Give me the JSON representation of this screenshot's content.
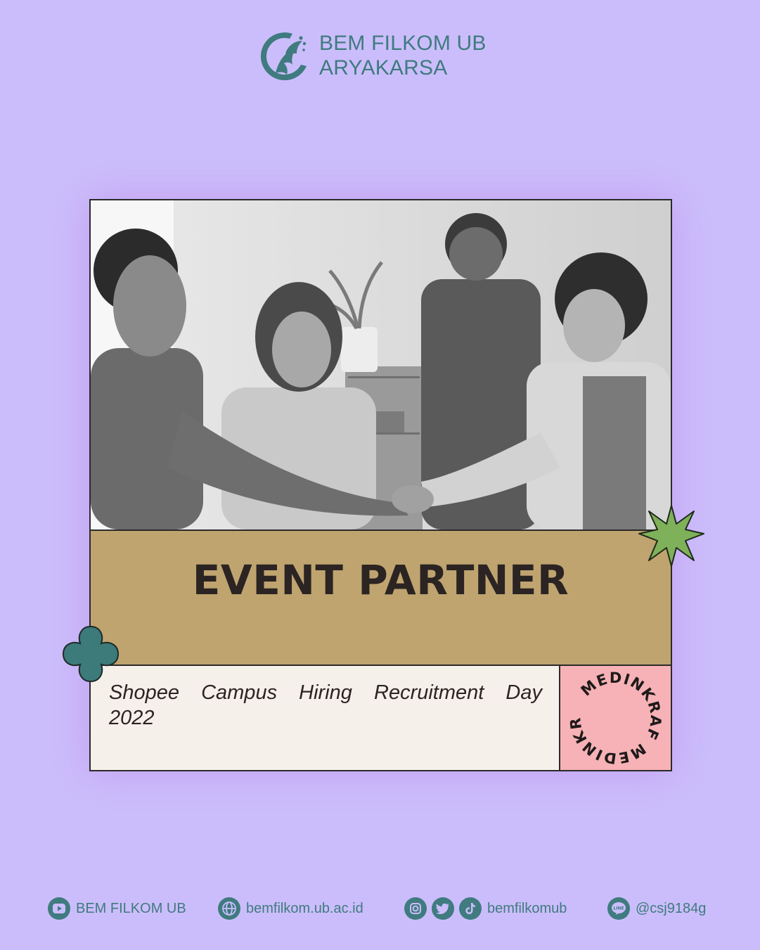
{
  "header": {
    "org_line1": "BEM FILKOM UB",
    "org_line2": "ARYAKARSA",
    "logo_icon": "phoenix-logo-icon"
  },
  "card": {
    "photo_description_icon": "business-handshake-photo",
    "title": "EVENT PARTNER",
    "caption": "Shopee Campus Hiring Recruitment Day 2022",
    "stamp_text": "MEDINKRAF MEDINKRAF"
  },
  "footer": {
    "youtube": {
      "icon": "youtube-icon",
      "label": "BEM FILKOM UB"
    },
    "website": {
      "icon": "globe-icon",
      "label": "bemfilkom.ub.ac.id"
    },
    "socials": {
      "icons": [
        "instagram-icon",
        "twitter-icon",
        "tiktok-icon"
      ],
      "label": "bemfilkomub"
    },
    "line": {
      "icon": "line-icon",
      "label": "@csj9184g"
    }
  },
  "colors": {
    "background": "#cbbdfb",
    "teal": "#3f7b7f",
    "title_band": "#bfa46f",
    "stamp_bg": "#f6b2b6",
    "caption_bg": "#f6f0ea",
    "starburst": "#7fb05a",
    "text_dark": "#2b2423"
  }
}
